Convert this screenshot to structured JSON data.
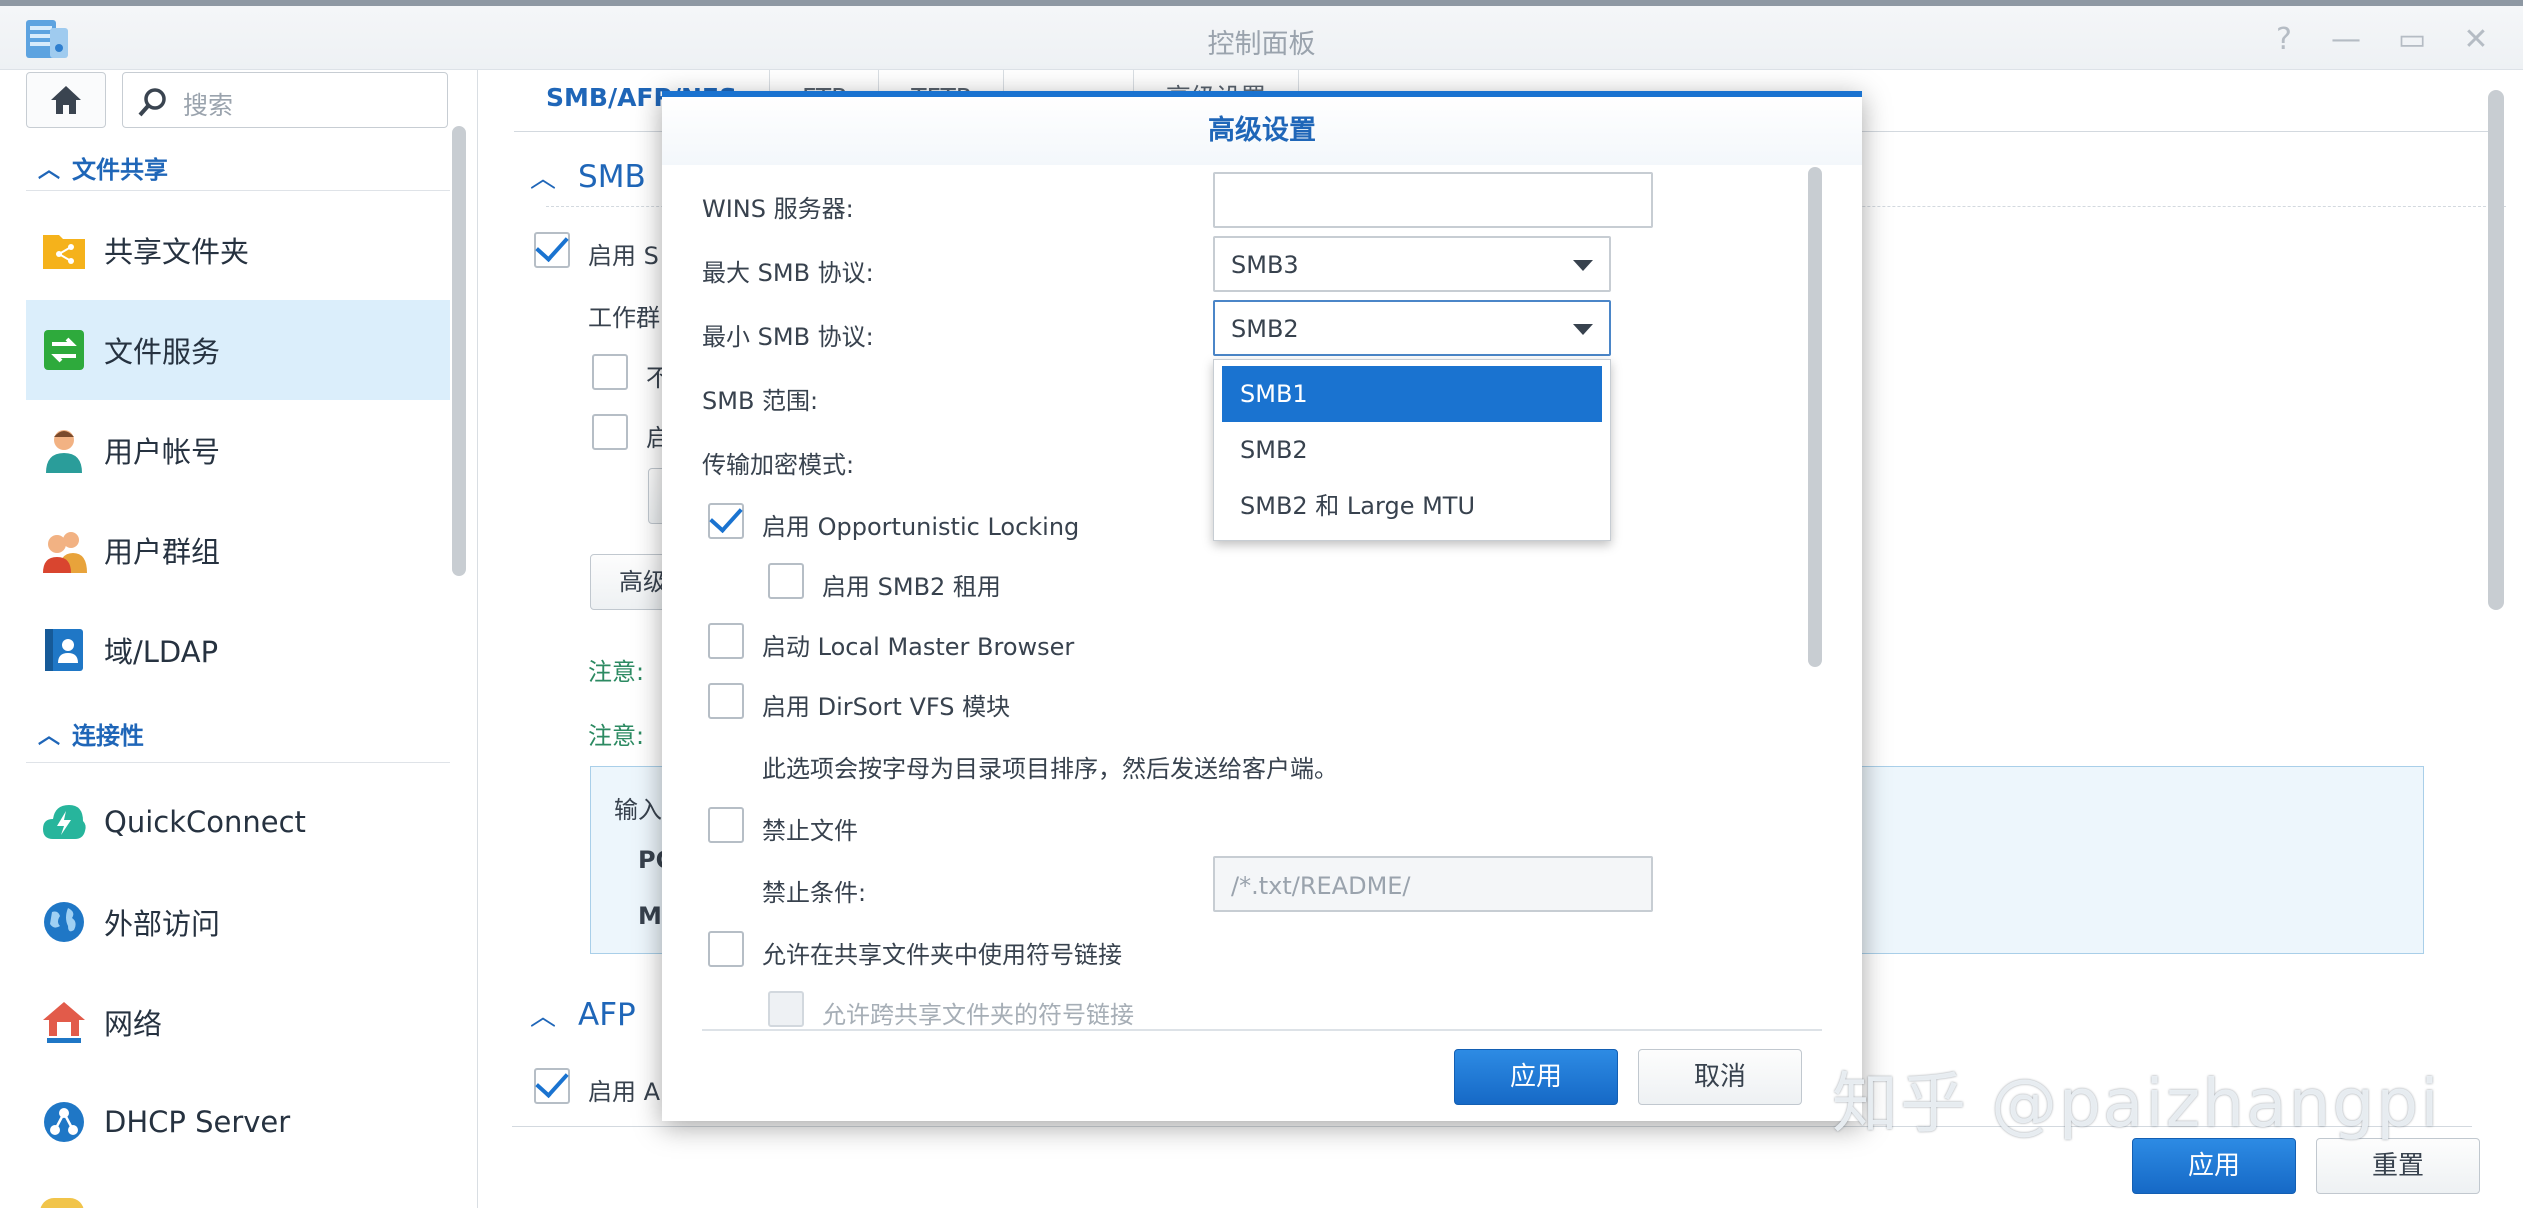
{
  "window": {
    "title": "控制面板",
    "help": "?",
    "minimize": "—",
    "maximize": "▭",
    "close": "✕"
  },
  "sidebar": {
    "search_placeholder": "搜索",
    "section1": "文件共享",
    "section2": "连接性",
    "items": [
      {
        "label": "共享文件夹"
      },
      {
        "label": "文件服务"
      },
      {
        "label": "用户帐号"
      },
      {
        "label": "用户群组"
      },
      {
        "label": "域/LDAP"
      },
      {
        "label": "QuickConnect"
      },
      {
        "label": "外部访问"
      },
      {
        "label": "网络"
      },
      {
        "label": "DHCP Server"
      }
    ]
  },
  "main": {
    "tabs": [
      "SMB/AFP/NFS",
      "FTP",
      "TFTP",
      "",
      "高级设置"
    ],
    "smb_section": "SMB",
    "smb_enable": "启用 S",
    "workgroup": "工作群",
    "opt_a": "不",
    "opt_b": "启",
    "advanced_btn": "高级",
    "note1": "注意:",
    "note2": "注意:",
    "info_line1": "输入",
    "info_line2": "PC",
    "info_line3": "M",
    "afp_section": "AFP",
    "afp_enable": "启用 A",
    "apply": "应用",
    "reset": "重置"
  },
  "modal": {
    "title": "高级设置",
    "wins_label": "WINS 服务器:",
    "wins_value": "",
    "max_smb_label": "最大 SMB 协议:",
    "max_smb_value": "SMB3",
    "min_smb_label": "最小 SMB 协议:",
    "min_smb_value": "SMB2",
    "smb_range_label": "SMB 范围:",
    "encrypt_label": "传输加密模式:",
    "oplock_label": "启用 Opportunistic Locking",
    "oplock_checked": true,
    "smb2_lease_label": "启用 SMB2 租用",
    "smb2_lease_checked": false,
    "local_master_label": "启动 Local Master Browser",
    "local_master_checked": false,
    "dirsort_label": "启用 DirSort VFS 模块",
    "dirsort_checked": false,
    "dirsort_desc": "此选项会按字母为目录项目排序，然后发送给客户端。",
    "veto_label": "禁止文件",
    "veto_checked": false,
    "veto_cond_label": "禁止条件:",
    "veto_cond_placeholder": "/*.txt/README/",
    "symlink_label": "允许在共享文件夹中使用符号链接",
    "symlink_checked": false,
    "cross_symlink_label": "允许跨共享文件夹的符号链接",
    "dropdown_options": [
      "SMB1",
      "SMB2",
      "SMB2 和 Large MTU"
    ],
    "dropdown_selected": "SMB1",
    "apply": "应用",
    "cancel": "取消"
  },
  "watermark": "知乎 @paizhangpi"
}
